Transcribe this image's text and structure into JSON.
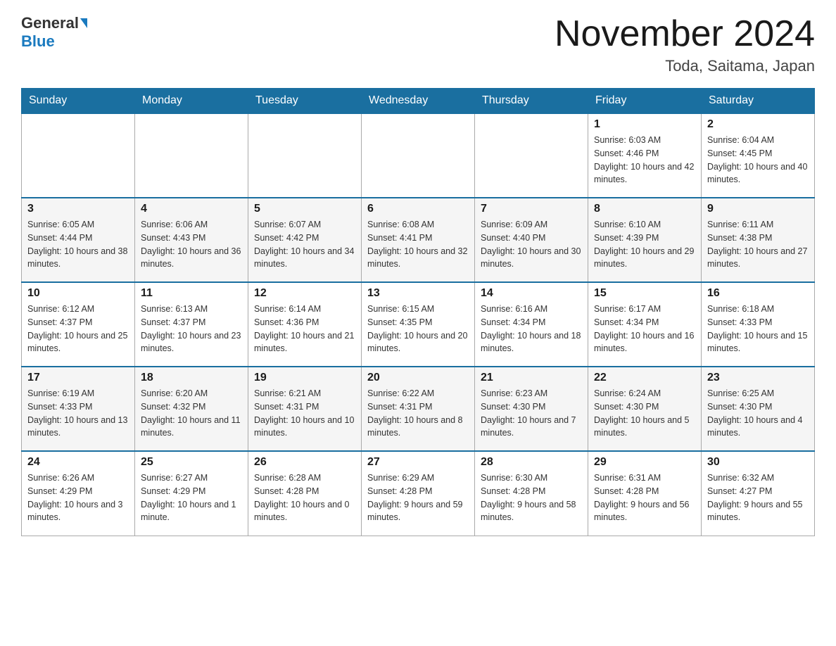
{
  "logo": {
    "general": "General",
    "blue": "Blue"
  },
  "header": {
    "month": "November 2024",
    "location": "Toda, Saitama, Japan"
  },
  "weekdays": [
    "Sunday",
    "Monday",
    "Tuesday",
    "Wednesday",
    "Thursday",
    "Friday",
    "Saturday"
  ],
  "weeks": [
    [
      {
        "day": "",
        "sunrise": "",
        "sunset": "",
        "daylight": ""
      },
      {
        "day": "",
        "sunrise": "",
        "sunset": "",
        "daylight": ""
      },
      {
        "day": "",
        "sunrise": "",
        "sunset": "",
        "daylight": ""
      },
      {
        "day": "",
        "sunrise": "",
        "sunset": "",
        "daylight": ""
      },
      {
        "day": "",
        "sunrise": "",
        "sunset": "",
        "daylight": ""
      },
      {
        "day": "1",
        "sunrise": "Sunrise: 6:03 AM",
        "sunset": "Sunset: 4:46 PM",
        "daylight": "Daylight: 10 hours and 42 minutes."
      },
      {
        "day": "2",
        "sunrise": "Sunrise: 6:04 AM",
        "sunset": "Sunset: 4:45 PM",
        "daylight": "Daylight: 10 hours and 40 minutes."
      }
    ],
    [
      {
        "day": "3",
        "sunrise": "Sunrise: 6:05 AM",
        "sunset": "Sunset: 4:44 PM",
        "daylight": "Daylight: 10 hours and 38 minutes."
      },
      {
        "day": "4",
        "sunrise": "Sunrise: 6:06 AM",
        "sunset": "Sunset: 4:43 PM",
        "daylight": "Daylight: 10 hours and 36 minutes."
      },
      {
        "day": "5",
        "sunrise": "Sunrise: 6:07 AM",
        "sunset": "Sunset: 4:42 PM",
        "daylight": "Daylight: 10 hours and 34 minutes."
      },
      {
        "day": "6",
        "sunrise": "Sunrise: 6:08 AM",
        "sunset": "Sunset: 4:41 PM",
        "daylight": "Daylight: 10 hours and 32 minutes."
      },
      {
        "day": "7",
        "sunrise": "Sunrise: 6:09 AM",
        "sunset": "Sunset: 4:40 PM",
        "daylight": "Daylight: 10 hours and 30 minutes."
      },
      {
        "day": "8",
        "sunrise": "Sunrise: 6:10 AM",
        "sunset": "Sunset: 4:39 PM",
        "daylight": "Daylight: 10 hours and 29 minutes."
      },
      {
        "day": "9",
        "sunrise": "Sunrise: 6:11 AM",
        "sunset": "Sunset: 4:38 PM",
        "daylight": "Daylight: 10 hours and 27 minutes."
      }
    ],
    [
      {
        "day": "10",
        "sunrise": "Sunrise: 6:12 AM",
        "sunset": "Sunset: 4:37 PM",
        "daylight": "Daylight: 10 hours and 25 minutes."
      },
      {
        "day": "11",
        "sunrise": "Sunrise: 6:13 AM",
        "sunset": "Sunset: 4:37 PM",
        "daylight": "Daylight: 10 hours and 23 minutes."
      },
      {
        "day": "12",
        "sunrise": "Sunrise: 6:14 AM",
        "sunset": "Sunset: 4:36 PM",
        "daylight": "Daylight: 10 hours and 21 minutes."
      },
      {
        "day": "13",
        "sunrise": "Sunrise: 6:15 AM",
        "sunset": "Sunset: 4:35 PM",
        "daylight": "Daylight: 10 hours and 20 minutes."
      },
      {
        "day": "14",
        "sunrise": "Sunrise: 6:16 AM",
        "sunset": "Sunset: 4:34 PM",
        "daylight": "Daylight: 10 hours and 18 minutes."
      },
      {
        "day": "15",
        "sunrise": "Sunrise: 6:17 AM",
        "sunset": "Sunset: 4:34 PM",
        "daylight": "Daylight: 10 hours and 16 minutes."
      },
      {
        "day": "16",
        "sunrise": "Sunrise: 6:18 AM",
        "sunset": "Sunset: 4:33 PM",
        "daylight": "Daylight: 10 hours and 15 minutes."
      }
    ],
    [
      {
        "day": "17",
        "sunrise": "Sunrise: 6:19 AM",
        "sunset": "Sunset: 4:33 PM",
        "daylight": "Daylight: 10 hours and 13 minutes."
      },
      {
        "day": "18",
        "sunrise": "Sunrise: 6:20 AM",
        "sunset": "Sunset: 4:32 PM",
        "daylight": "Daylight: 10 hours and 11 minutes."
      },
      {
        "day": "19",
        "sunrise": "Sunrise: 6:21 AM",
        "sunset": "Sunset: 4:31 PM",
        "daylight": "Daylight: 10 hours and 10 minutes."
      },
      {
        "day": "20",
        "sunrise": "Sunrise: 6:22 AM",
        "sunset": "Sunset: 4:31 PM",
        "daylight": "Daylight: 10 hours and 8 minutes."
      },
      {
        "day": "21",
        "sunrise": "Sunrise: 6:23 AM",
        "sunset": "Sunset: 4:30 PM",
        "daylight": "Daylight: 10 hours and 7 minutes."
      },
      {
        "day": "22",
        "sunrise": "Sunrise: 6:24 AM",
        "sunset": "Sunset: 4:30 PM",
        "daylight": "Daylight: 10 hours and 5 minutes."
      },
      {
        "day": "23",
        "sunrise": "Sunrise: 6:25 AM",
        "sunset": "Sunset: 4:30 PM",
        "daylight": "Daylight: 10 hours and 4 minutes."
      }
    ],
    [
      {
        "day": "24",
        "sunrise": "Sunrise: 6:26 AM",
        "sunset": "Sunset: 4:29 PM",
        "daylight": "Daylight: 10 hours and 3 minutes."
      },
      {
        "day": "25",
        "sunrise": "Sunrise: 6:27 AM",
        "sunset": "Sunset: 4:29 PM",
        "daylight": "Daylight: 10 hours and 1 minute."
      },
      {
        "day": "26",
        "sunrise": "Sunrise: 6:28 AM",
        "sunset": "Sunset: 4:28 PM",
        "daylight": "Daylight: 10 hours and 0 minutes."
      },
      {
        "day": "27",
        "sunrise": "Sunrise: 6:29 AM",
        "sunset": "Sunset: 4:28 PM",
        "daylight": "Daylight: 9 hours and 59 minutes."
      },
      {
        "day": "28",
        "sunrise": "Sunrise: 6:30 AM",
        "sunset": "Sunset: 4:28 PM",
        "daylight": "Daylight: 9 hours and 58 minutes."
      },
      {
        "day": "29",
        "sunrise": "Sunrise: 6:31 AM",
        "sunset": "Sunset: 4:28 PM",
        "daylight": "Daylight: 9 hours and 56 minutes."
      },
      {
        "day": "30",
        "sunrise": "Sunrise: 6:32 AM",
        "sunset": "Sunset: 4:27 PM",
        "daylight": "Daylight: 9 hours and 55 minutes."
      }
    ]
  ]
}
